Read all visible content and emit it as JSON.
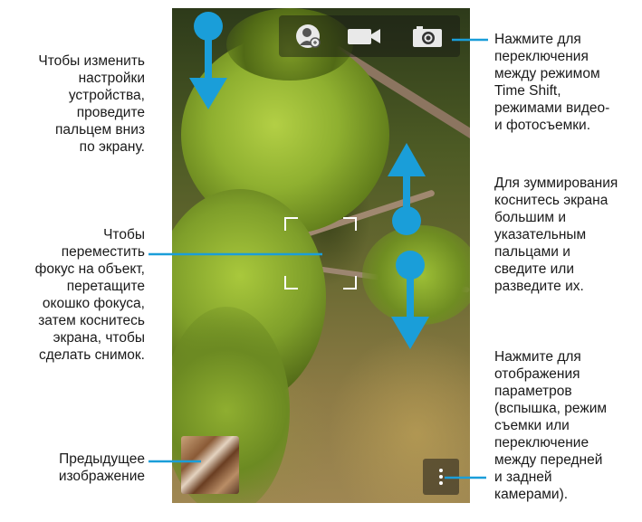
{
  "captions": {
    "settings": "Чтобы изменить\nнастройки\nустройства,\nпроведите\nпальцем вниз\nпо экрану.",
    "focus": "Чтобы\nпереместить\nфокус на объект,\nперетащите\nокошко фокуса,\nзатем коснитесь\nэкрана, чтобы\nсделать снимок.",
    "previous": "Предыдущее\nизображение",
    "modes": "Нажмите для\nпереключения\nмежду режимом\nTime Shift,\nрежимами видео-\nи фотосъемки.",
    "zoom": "Для зуммирования\nкоснитесь экрана\nбольшим и\nуказательным\nпальцами и\nсведите или\nразведите их.",
    "options": "Нажмите для\nотображения\nпараметров\n(вспышка, режим\nсъемки или\nпереключение\nмежду передней\nи задней\nкамерами)."
  },
  "camera": {
    "modes": [
      "time-shift-icon",
      "video-camera-icon",
      "photo-camera-icon"
    ]
  },
  "colors": {
    "accent": "#1a9ed9",
    "arrow": "#1a9ed9",
    "caption_text": "#1a1a1a"
  }
}
